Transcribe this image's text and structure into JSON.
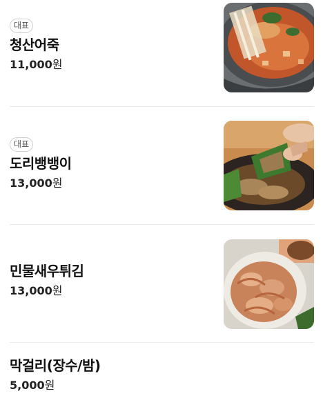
{
  "menu": {
    "items": [
      {
        "badge": "대표",
        "name": "청산어죽",
        "price": "11,000",
        "currency": "원",
        "image": "eojuk-fish-porridge-photo"
      },
      {
        "badge": "대표",
        "name": "도리뱅뱅이",
        "price": "13,000",
        "currency": "원",
        "image": "doribaengbaengi-fried-fish-photo"
      },
      {
        "badge": "",
        "name": "민물새우튀김",
        "price": "13,000",
        "currency": "원",
        "image": "fried-freshwater-shrimp-photo"
      },
      {
        "badge": "",
        "name": "막걸리(장수/밤)",
        "price": "5,000",
        "currency": "원",
        "image": ""
      }
    ]
  }
}
